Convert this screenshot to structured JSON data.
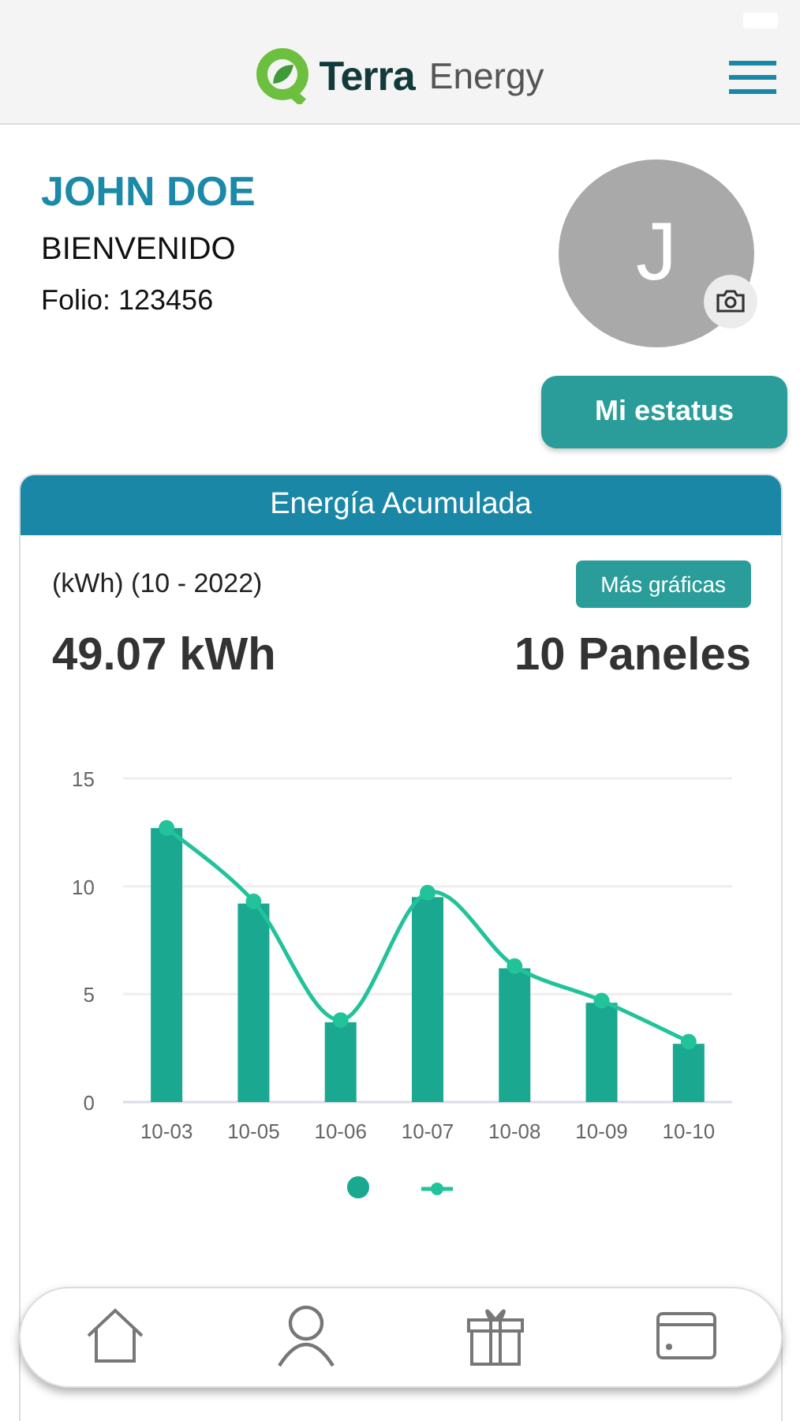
{
  "header": {
    "brand": "Terra",
    "brand_suffix": "Energy"
  },
  "profile": {
    "name": "JOHN DOE",
    "greeting": "BIENVENIDO",
    "folio": "Folio: 123456",
    "avatar_letter": "J",
    "status_button": "Mi estatus"
  },
  "energy_card": {
    "title": "Energía Acumulada",
    "period": "(kWh) (10 - 2022)",
    "more_button": "Más gráficas",
    "total": "49.07 kWh",
    "panels": "10 Paneles",
    "chart_data": {
      "type": "bar",
      "categories": [
        "10-03",
        "10-05",
        "10-06",
        "10-07",
        "10-08",
        "10-09",
        "10-10"
      ],
      "ylim": [
        0,
        15
      ],
      "yticks": [
        0,
        5,
        10,
        15
      ],
      "series": [
        {
          "type": "bar",
          "color": "#1aa891",
          "values": [
            12.7,
            9.2,
            3.7,
            9.5,
            6.2,
            4.6,
            2.7
          ]
        },
        {
          "type": "line",
          "marker": "circle",
          "color": "#22c29a",
          "values": [
            12.7,
            9.3,
            3.8,
            9.7,
            6.3,
            4.7,
            2.8
          ]
        }
      ]
    }
  },
  "bottom_nav": [
    {
      "kind": "home",
      "selected": false
    },
    {
      "kind": "profile",
      "selected": false
    },
    {
      "kind": "gift",
      "selected": false
    },
    {
      "kind": "card",
      "selected": false
    }
  ]
}
